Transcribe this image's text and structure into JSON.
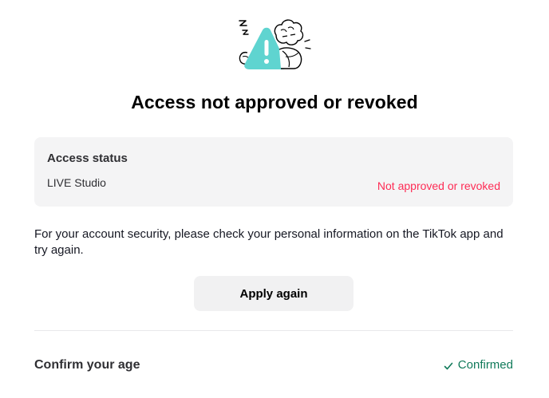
{
  "illustration": {
    "icon": "warning-illustration-icon",
    "accent_color": "#5fd4d0"
  },
  "title": "Access not approved or revoked",
  "status_card": {
    "heading": "Access status",
    "app_name": "LIVE Studio",
    "status": "Not approved or revoked",
    "status_color": "#fe2c55"
  },
  "info_text": "For your account security, please check your personal information on the TikTok app and try again.",
  "apply_button": {
    "label": "Apply again"
  },
  "age_section": {
    "label": "Confirm your age",
    "status": "Confirmed",
    "status_icon": "check-icon",
    "status_color": "#107a5a"
  }
}
